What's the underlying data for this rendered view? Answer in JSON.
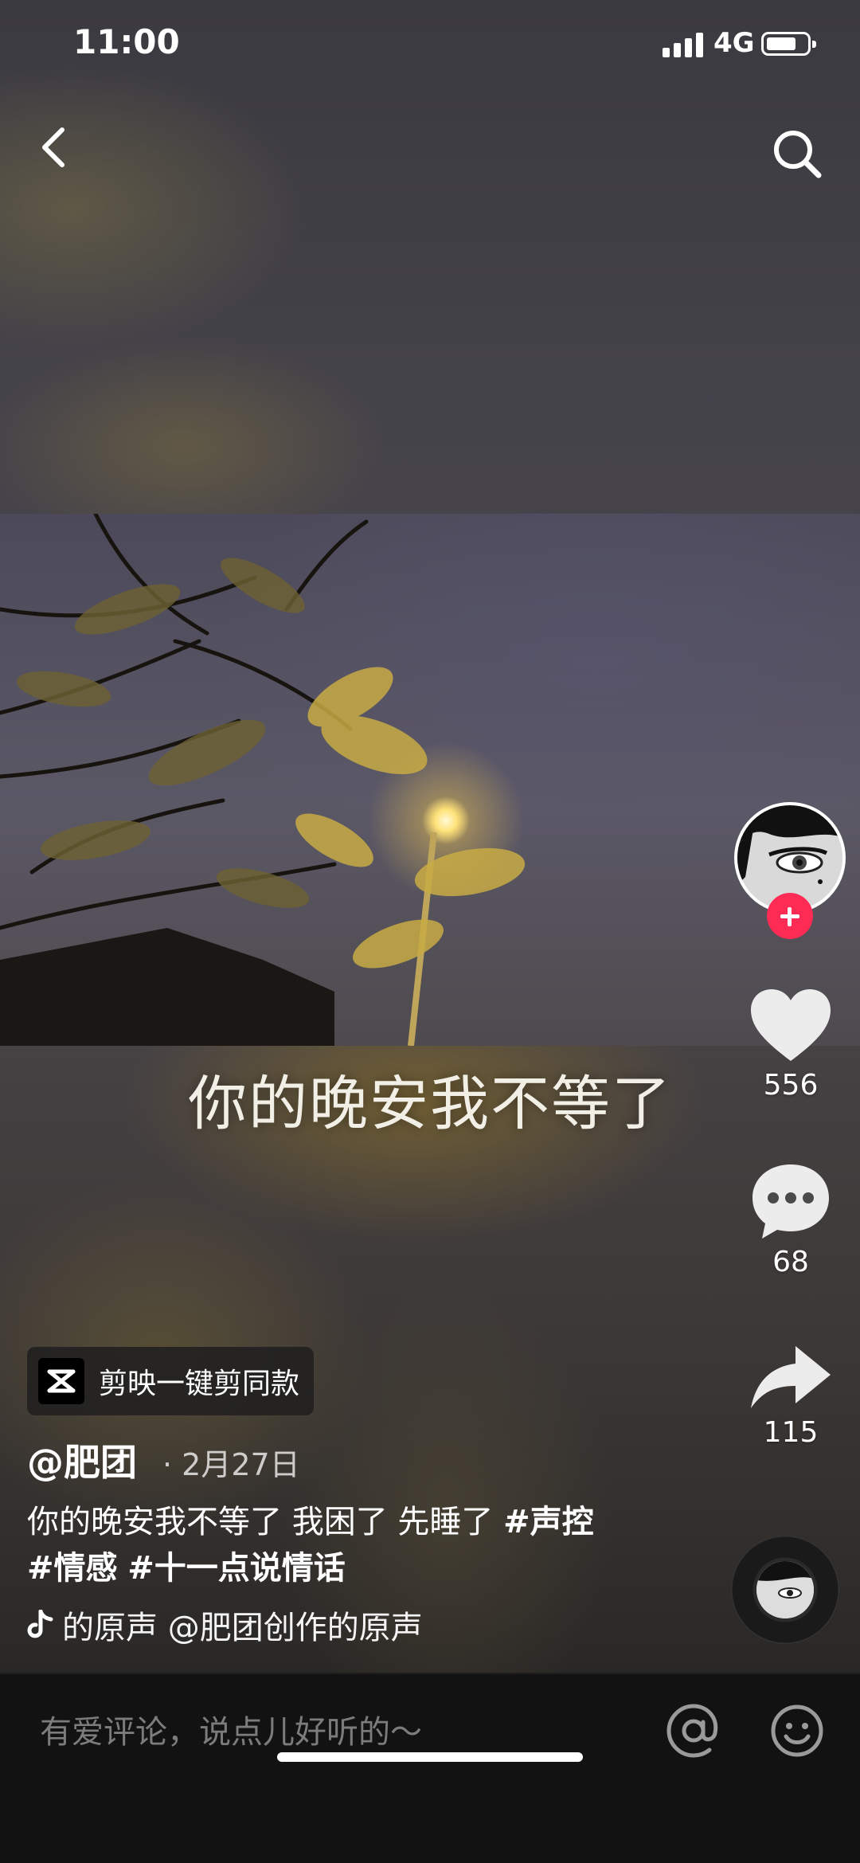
{
  "status_bar": {
    "time": "11:00",
    "network": "4G",
    "signal_bars": 4
  },
  "video": {
    "caption": "你的晚安我不等了"
  },
  "rail": {
    "likes": "556",
    "comments": "68",
    "shares": "115"
  },
  "capcut": {
    "label": "剪映一键剪同款"
  },
  "post": {
    "author": "@肥团",
    "date": "· 2月27日",
    "description": "你的晚安我不等了 我困了 先睡了 ",
    "tags": [
      "#声控",
      "#情感",
      "#十一点说情话"
    ],
    "music": "的原声    @肥团创作的原声"
  },
  "comment_bar": {
    "placeholder": "有爱评论，说点儿好听的～"
  },
  "colors": {
    "follow": "#fe2c55",
    "background": "#121212"
  },
  "icons": [
    "back-icon",
    "search-icon",
    "heart-icon",
    "comment-icon",
    "share-icon",
    "music-note-icon",
    "at-icon",
    "emoji-icon",
    "capcut-icon"
  ]
}
